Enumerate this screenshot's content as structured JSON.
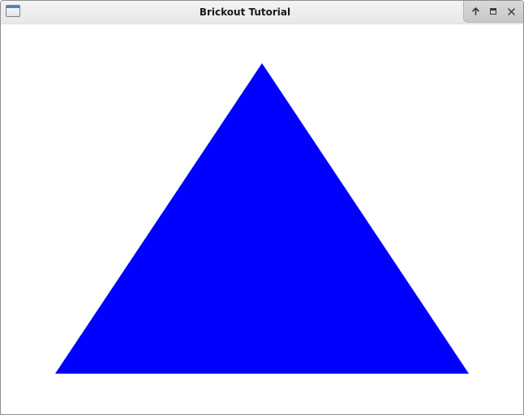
{
  "window": {
    "title": "Brickout Tutorial",
    "controls": {
      "up_icon": "arrow-up-icon",
      "maximize_icon": "maximize-icon",
      "close_icon": "close-icon"
    }
  },
  "canvas": {
    "background": "#ffffff",
    "shape": {
      "type": "triangle",
      "fill": "#0000ff"
    }
  }
}
